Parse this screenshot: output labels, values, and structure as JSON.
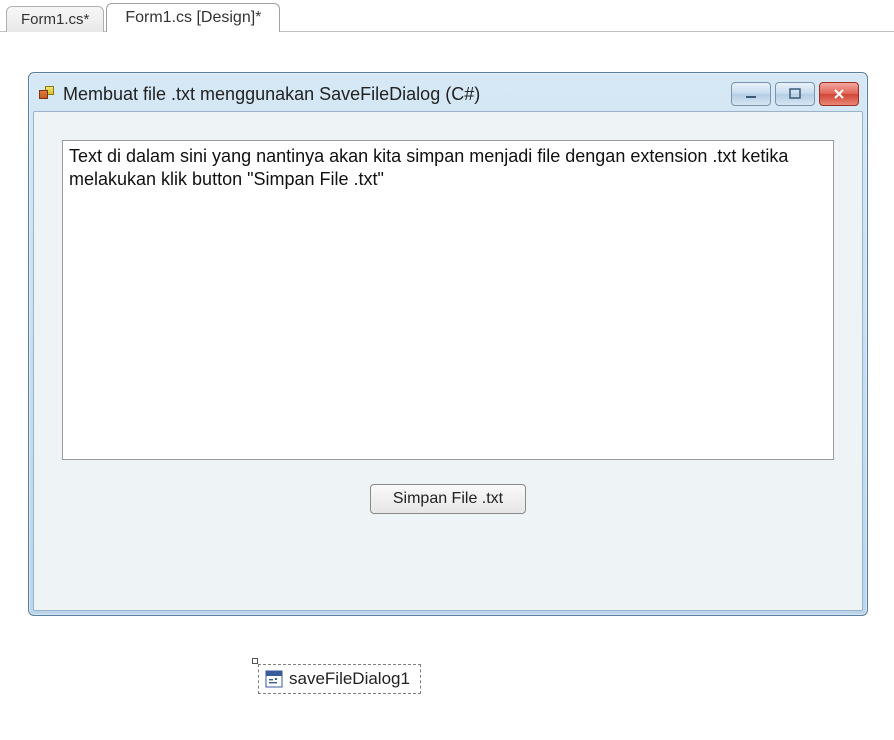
{
  "tabs": [
    {
      "label": "Form1.cs*"
    },
    {
      "label": "Form1.cs [Design]*"
    }
  ],
  "window": {
    "title": "Membuat file .txt menggunakan SaveFileDialog (C#)"
  },
  "form": {
    "textbox_value": "Text di dalam sini yang nantinya akan kita simpan menjadi file dengan extension .txt ketika melakukan klik button \"Simpan File .txt\"",
    "save_button_label": "Simpan File .txt"
  },
  "tray": {
    "saveFileDialog_label": "saveFileDialog1"
  }
}
